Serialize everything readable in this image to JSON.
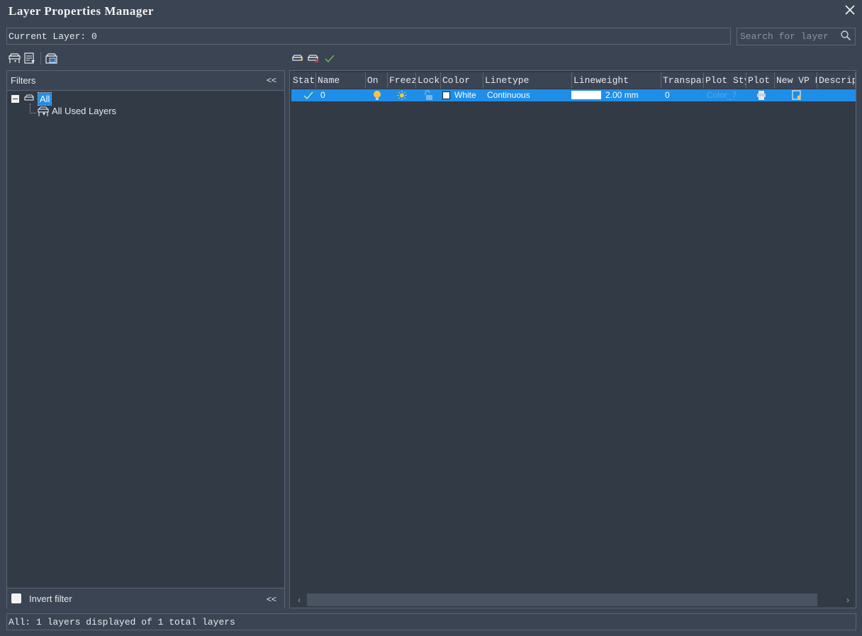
{
  "window": {
    "title": "Layer Properties Manager",
    "close_icon": "close-icon"
  },
  "current_layer": {
    "text": "Current Layer: 0"
  },
  "search": {
    "placeholder": "Search for layer",
    "value": ""
  },
  "toolbar_left": [
    "new-filter-icon",
    "properties-filter-icon",
    "layer-states-icon"
  ],
  "toolbar_right": [
    "new-layer-icon",
    "delete-layer-icon",
    "set-current-icon"
  ],
  "filters": {
    "header": "Filters",
    "collapse": "<<",
    "tree": {
      "root": "All",
      "children": [
        "All Used Layers"
      ]
    },
    "invert_label": "Invert filter",
    "invert_checked": false,
    "bottom_collapse": "<<"
  },
  "grid": {
    "columns": [
      "Status",
      "Name",
      "On",
      "Freeze",
      "Lock",
      "Color",
      "Linetype",
      "Lineweight",
      "Transparency",
      "Plot Style",
      "Plot",
      "New VP Freeze",
      "Description"
    ],
    "rows": [
      {
        "status": "current",
        "name": "0",
        "on": true,
        "frozen": false,
        "locked": false,
        "color_name": "White",
        "color_hex": "#ffffff",
        "linetype": "Continuous",
        "lineweight": "2.00 mm",
        "transparency": "0",
        "plot_style": "Color_7",
        "plot": true,
        "description": ""
      }
    ]
  },
  "status_text": "All: 1 layers displayed of 1 total layers",
  "colors": {
    "background": "#3b4453",
    "panel": "#323a45",
    "selection": "#1e8ee8",
    "bulb": "#f5c542",
    "sun": "#f5c542"
  }
}
